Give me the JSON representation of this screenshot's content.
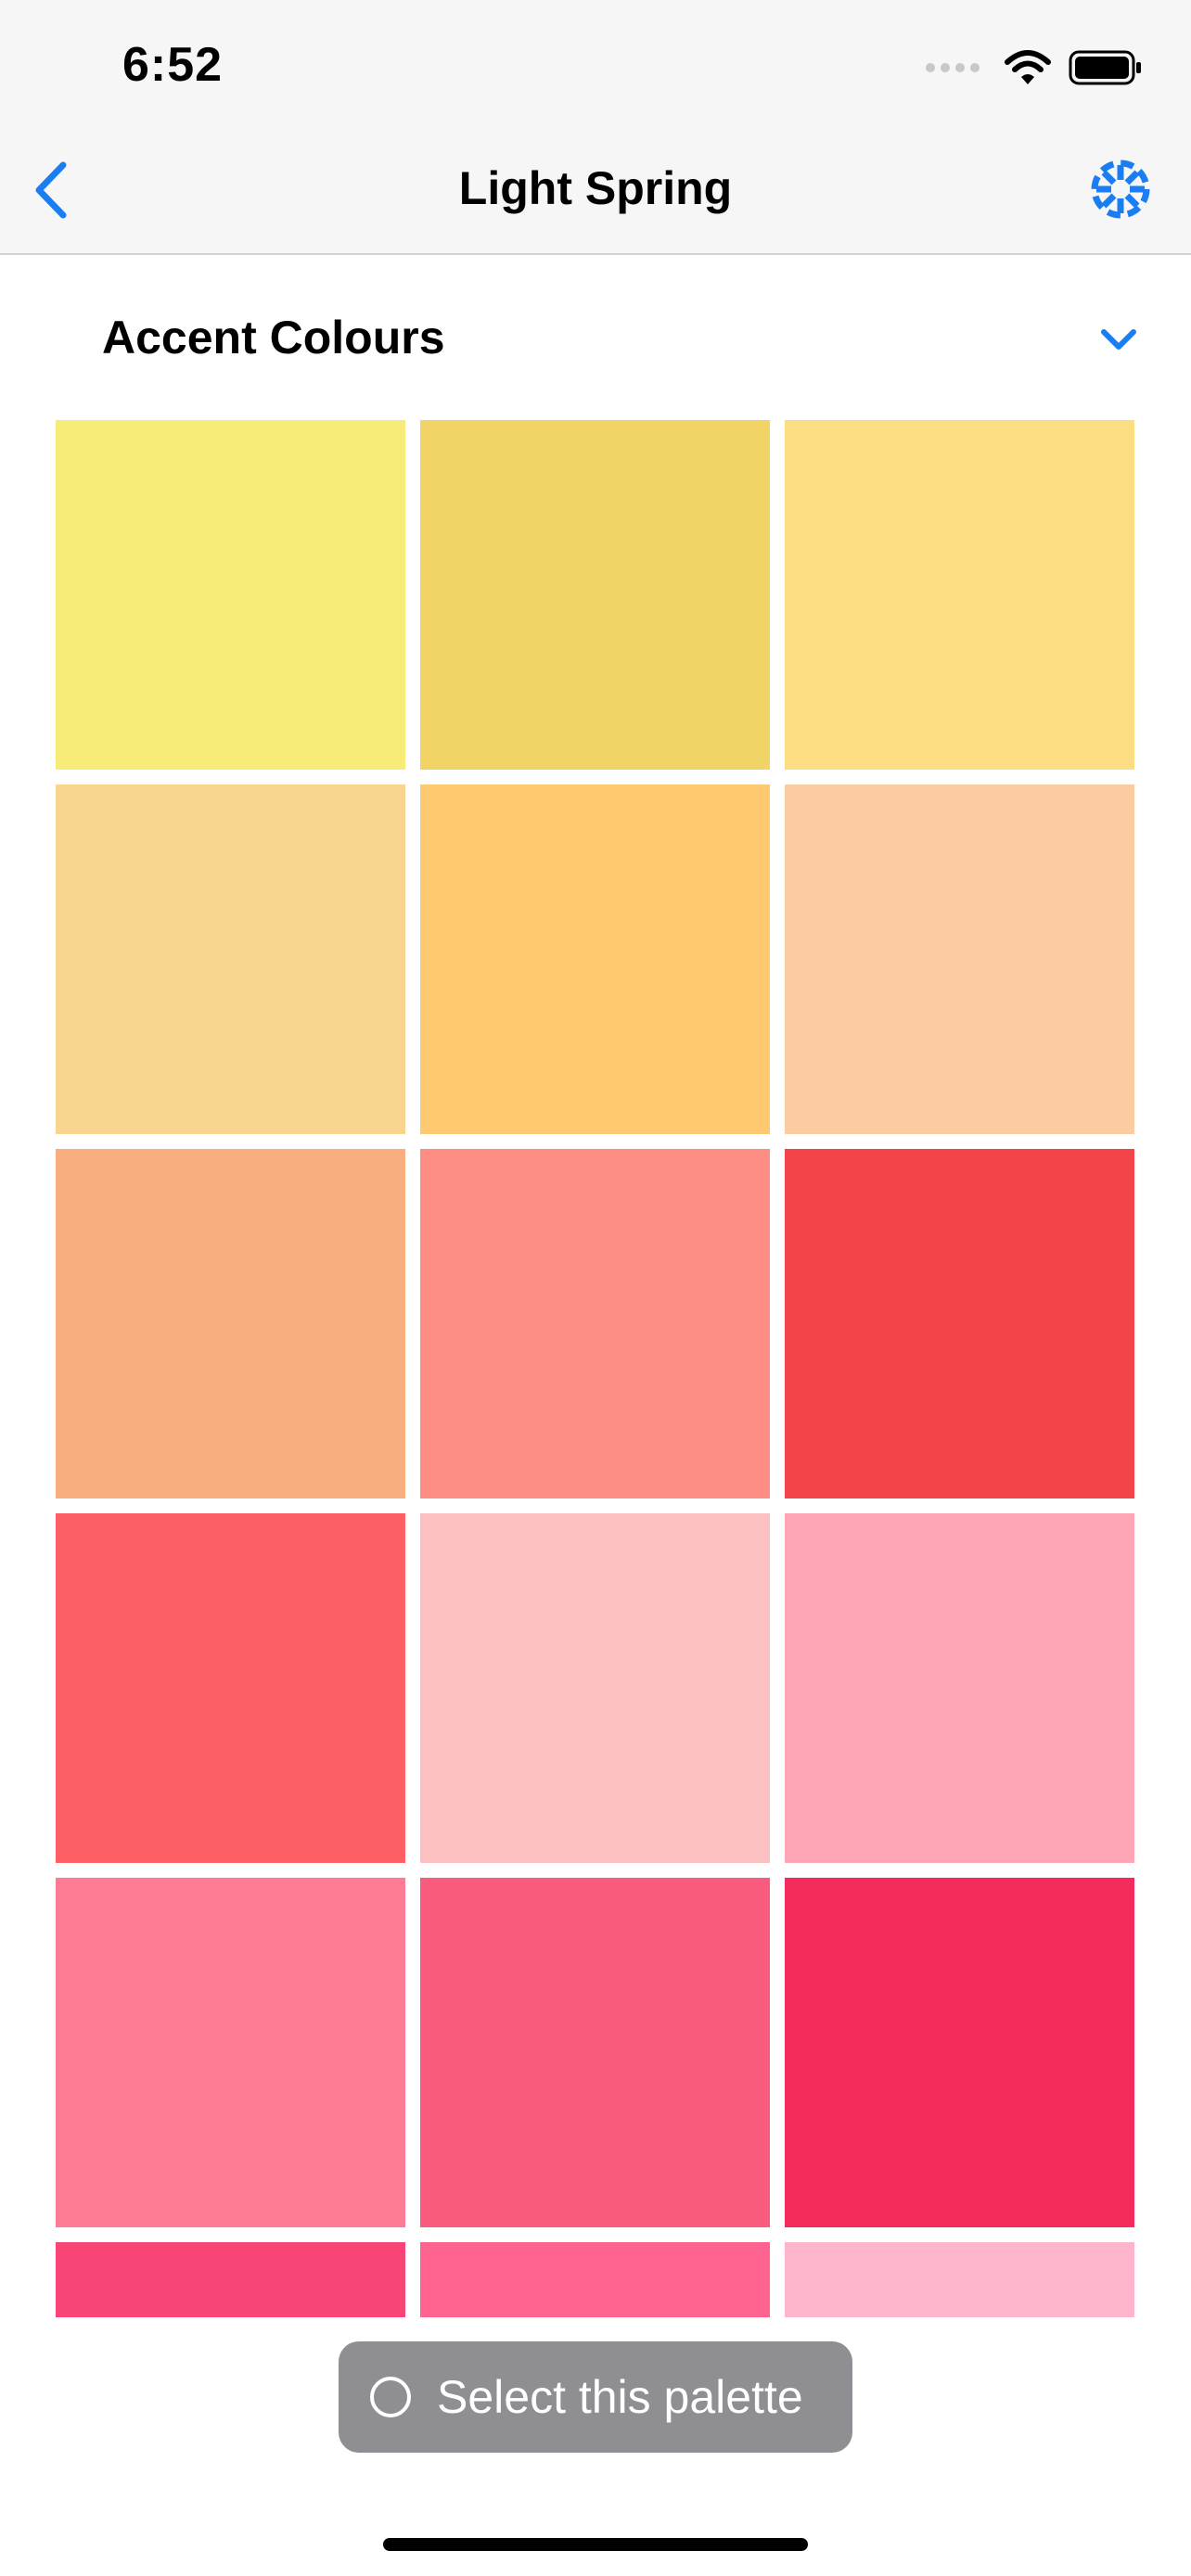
{
  "status_bar": {
    "time": "6:52"
  },
  "nav": {
    "title": "Light Spring"
  },
  "section": {
    "title": "Accent Colours"
  },
  "swatches": [
    "#f8ec79",
    "#f2d366",
    "#fcdd82",
    "#f9d48e",
    "#fec970",
    "#fbcca1",
    "#f8ae7f",
    "#fe8e84",
    "#f24449",
    "#fe5f65",
    "#fcc0c3",
    "#fea6b5",
    "#fe7b95",
    "#f85b7d",
    "#f62b5d",
    "#f94476",
    "#fe6390",
    "#feb4ca"
  ],
  "select_button": {
    "label": "Select this palette"
  },
  "colors": {
    "accent": "#1a7ef2",
    "button_bg": "#8e8e93"
  }
}
